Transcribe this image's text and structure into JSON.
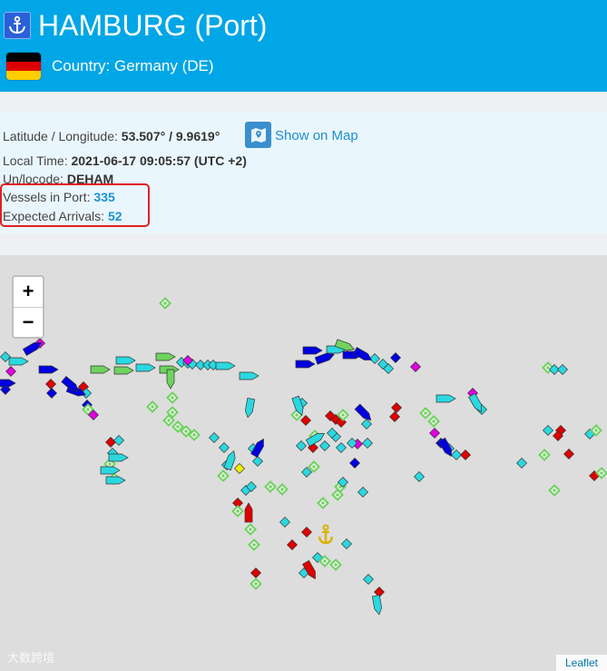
{
  "header": {
    "title": "HAMBURG (Port)",
    "country": "Country: Germany (DE)",
    "port_icon": "anchor-icon",
    "flag_colors": [
      "#000000",
      "#dd0000",
      "#ffce00"
    ]
  },
  "info": {
    "latlon_label": "Latitude / Longitude:",
    "latlon_value": "53.507° / 9.9619°",
    "show_on_map": "Show on Map",
    "local_time_label": "Local Time:",
    "local_time_value": "2021-06-17 09:05:57 (UTC +2)",
    "unlocode_label": "Un/locode:",
    "unlocode_value": "DEHAM",
    "vessels_label": "Vessels in Port:",
    "vessels_value": "335",
    "arrivals_label": "Expected Arrivals:",
    "arrivals_value": "52",
    "highlight_color": "#e02020"
  },
  "map": {
    "zoom_in": "+",
    "zoom_out": "−",
    "attribution": "Leaflet",
    "watermark": "大数跨境",
    "port_marker_icon": "anchor-icon",
    "vessel_colors": {
      "cargo": "#6fd35f",
      "tanker": "#2ad8e0",
      "passenger": "#0000e0",
      "special": "#e00000",
      "pleasure": "#e000e0",
      "unknown": "#f0f000"
    }
  }
}
